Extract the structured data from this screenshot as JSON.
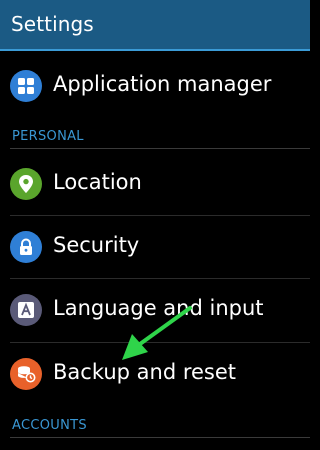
{
  "header": {
    "title": "Settings"
  },
  "items": [
    {
      "label": "Application manager",
      "icon": "grid-icon",
      "color": "#2f7fd6"
    },
    {
      "label": "Location",
      "icon": "location-pin-icon",
      "color": "#5aa52c"
    },
    {
      "label": "Security",
      "icon": "lock-icon",
      "color": "#2f7fd6"
    },
    {
      "label": "Language and input",
      "icon": "keyboard-a-icon",
      "color": "#5a5a78"
    },
    {
      "label": "Backup and reset",
      "icon": "backup-reset-icon",
      "color": "#e8612a"
    }
  ],
  "sections": {
    "personal": "PERSONAL",
    "accounts": "ACCOUNTS"
  },
  "colors": {
    "header_bg": "#1b5a84",
    "accent": "#3a97d3",
    "arrow": "#2fd44a"
  }
}
